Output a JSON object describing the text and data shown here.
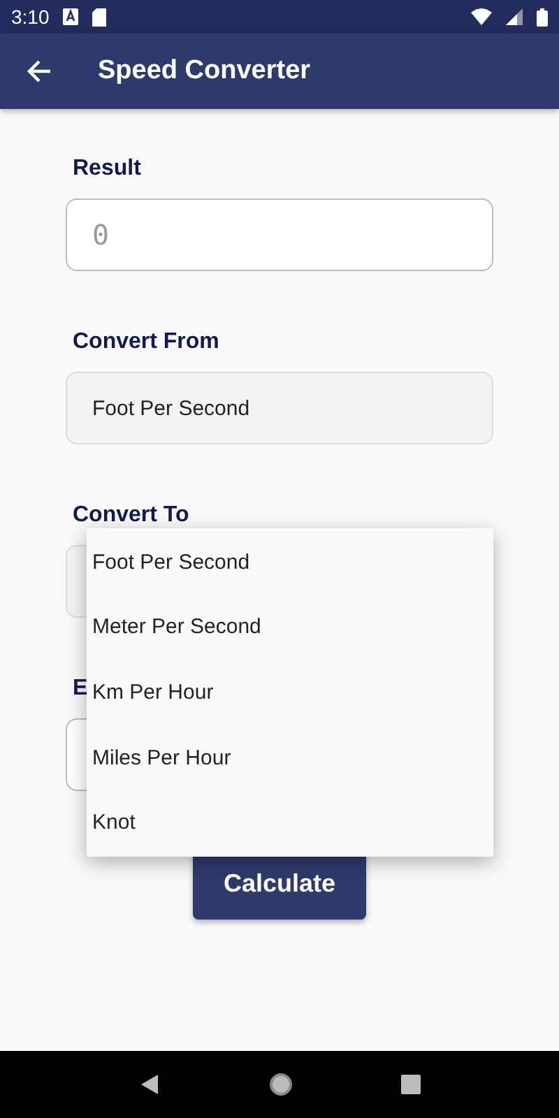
{
  "status_bar": {
    "time": "3:10"
  },
  "app_bar": {
    "title": "Speed Converter"
  },
  "fields": [
    {
      "label": "Result",
      "kind": "input",
      "value": "0"
    },
    {
      "label": "Convert From",
      "kind": "select",
      "value": "Foot Per Second"
    },
    {
      "label": "Convert To",
      "kind": "select"
    },
    {
      "label": "E",
      "kind": "input"
    }
  ],
  "button": {
    "label": "Calculate"
  },
  "menu": {
    "items": [
      "Foot Per Second",
      "Meter Per Second",
      "Km Per Hour",
      "Miles Per Hour",
      "Knot"
    ]
  }
}
